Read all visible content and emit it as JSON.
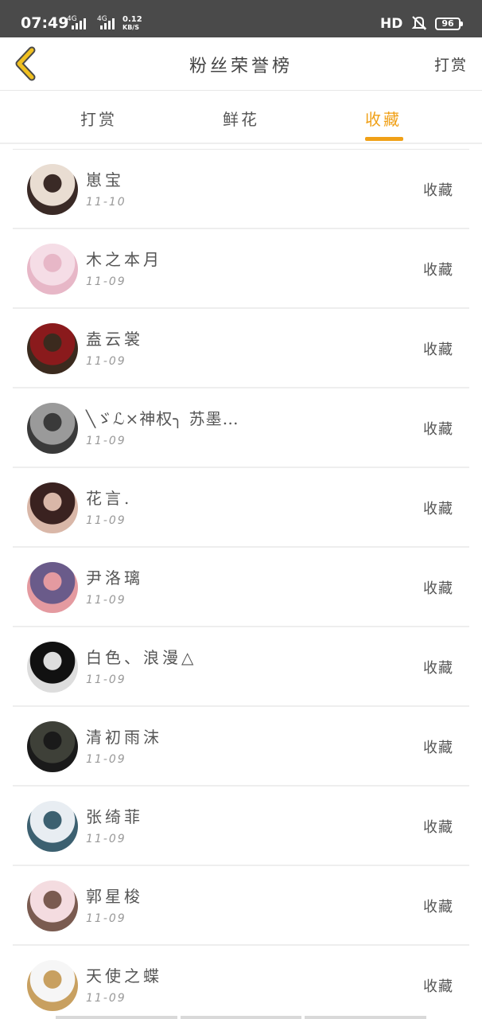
{
  "status_bar": {
    "time": "07:49",
    "network_1": "4G",
    "network_2": "4G",
    "speed_value": "0.12",
    "speed_unit": "KB/S",
    "hd": "HD",
    "battery": "96"
  },
  "nav": {
    "title": "粉丝荣誉榜",
    "right_action": "打赏",
    "back_icon": "chevron-left-icon",
    "back_color": "#f0c020"
  },
  "tabs": [
    {
      "label": "打赏"
    },
    {
      "label": "鲜花"
    },
    {
      "label": "收藏",
      "active": true
    }
  ],
  "accent_color": "#f0a017",
  "list": [
    {
      "name": "崽宝",
      "date": "11-10",
      "action": "收藏",
      "avatar_colors": [
        "#e9ddd2",
        "#3a2a26"
      ]
    },
    {
      "name": "木之本月",
      "date": "11-09",
      "action": "收藏",
      "avatar_colors": [
        "#f5dde6",
        "#e7b7c7"
      ]
    },
    {
      "name": "盍云裳",
      "date": "11-09",
      "action": "收藏",
      "avatar_colors": [
        "#8a1a1c",
        "#3b2a1e"
      ]
    },
    {
      "name": "╲ゞℒ×神权╮ 苏墨…",
      "date": "11-09",
      "action": "收藏",
      "avatar_colors": [
        "#9a9a9a",
        "#3a3a3a"
      ]
    },
    {
      "name": "花言.",
      "date": "11-09",
      "action": "收藏",
      "avatar_colors": [
        "#3a2220",
        "#d9b7a8"
      ]
    },
    {
      "name": "尹洛璃",
      "date": "11-09",
      "action": "收藏",
      "avatar_colors": [
        "#6a5b8a",
        "#e49aa0"
      ]
    },
    {
      "name": "白色、浪漫△",
      "date": "11-09",
      "action": "收藏",
      "avatar_colors": [
        "#111111",
        "#dddddd"
      ]
    },
    {
      "name": "清初雨沫",
      "date": "11-09",
      "action": "收藏",
      "avatar_colors": [
        "#3e4038",
        "#1a1a1a"
      ]
    },
    {
      "name": "张绮菲",
      "date": "11-09",
      "action": "收藏",
      "avatar_colors": [
        "#e8edf2",
        "#3c6070"
      ]
    },
    {
      "name": "郭星梭",
      "date": "11-09",
      "action": "收藏",
      "avatar_colors": [
        "#f4dce0",
        "#7a5b50"
      ]
    },
    {
      "name": "天使之蝶",
      "date": "11-09",
      "action": "收藏",
      "avatar_colors": [
        "#f6f6f6",
        "#c8a060"
      ]
    }
  ]
}
